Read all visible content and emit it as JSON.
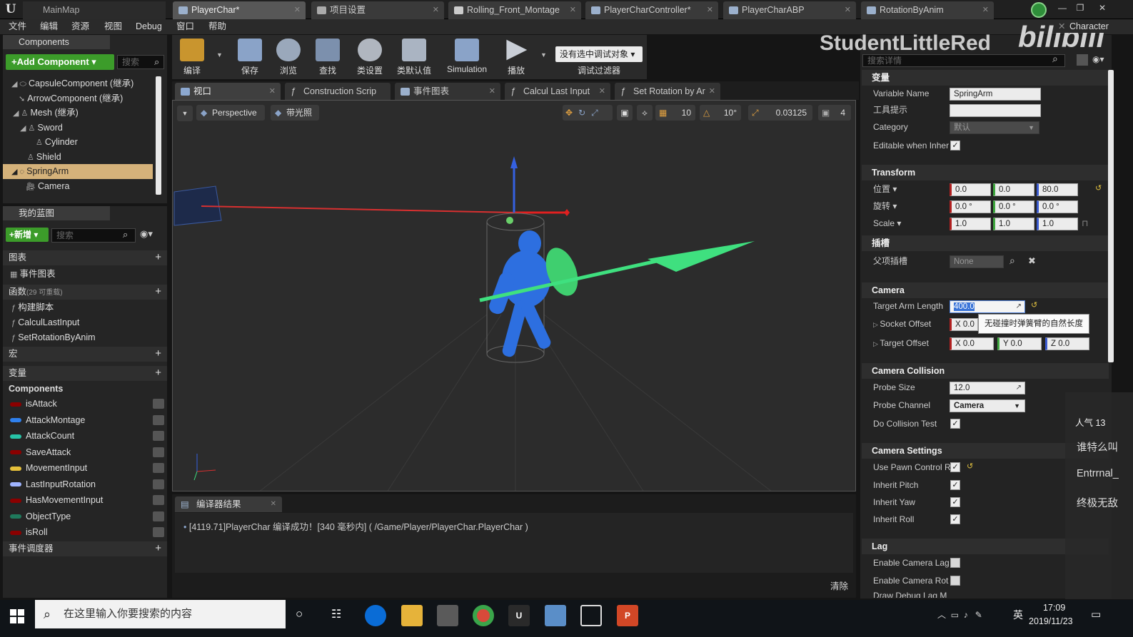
{
  "window_tabs": {
    "main": "MainMap",
    "docs": [
      {
        "label": "PlayerChar*",
        "active": true
      },
      {
        "label": "项目设置",
        "active": false
      },
      {
        "label": "Rolling_Front_Montage",
        "active": false
      },
      {
        "label": "PlayerCharController*",
        "active": false
      },
      {
        "label": "PlayerCharABP",
        "active": false
      },
      {
        "label": "RotationByAnim",
        "active": false
      }
    ],
    "right_label": "Character"
  },
  "menu": [
    "文件",
    "编辑",
    "资源",
    "视图",
    "Debug",
    "窗口",
    "帮助"
  ],
  "components_panel": {
    "title": "Components",
    "add_button": "+Add Component ▾",
    "search_placeholder": "搜索",
    "tree": [
      {
        "label": "CapsuleComponent (继承)",
        "indent": 0,
        "selected": false
      },
      {
        "label": "ArrowComponent (继承)",
        "indent": 1,
        "selected": false
      },
      {
        "label": "Mesh (继承)",
        "indent": 1,
        "selected": false
      },
      {
        "label": "Sword",
        "indent": 2,
        "selected": false
      },
      {
        "label": "Cylinder",
        "indent": 3,
        "selected": false
      },
      {
        "label": "Shield",
        "indent": 2,
        "selected": false
      },
      {
        "label": "SpringArm",
        "indent": 1,
        "selected": true
      },
      {
        "label": "Camera",
        "indent": 2,
        "selected": false
      }
    ]
  },
  "my_blueprint": {
    "title": "我的蓝图",
    "new_button": "+新增 ▾",
    "search_placeholder": "搜索",
    "sections": {
      "graphs": "图表",
      "event_graph": "事件图表",
      "functions": "函数",
      "functions_count": "(29 可重载)",
      "macros": "宏",
      "variables": "变量",
      "components": "Components",
      "dispatchers": "事件调度器"
    },
    "functions_list": [
      "构建脚本",
      "CalculLastInput",
      "SetRotationByAnim"
    ],
    "variables_list": [
      {
        "name": "isAttack",
        "color": "#8b0000"
      },
      {
        "name": "AttackMontage",
        "color": "#2f80ed"
      },
      {
        "name": "AttackCount",
        "color": "#27c3a6"
      },
      {
        "name": "SaveAttack",
        "color": "#8b0000"
      },
      {
        "name": "MovementInput",
        "color": "#e5c03a"
      },
      {
        "name": "LastInputRotation",
        "color": "#9fb4ff"
      },
      {
        "name": "HasMovementInput",
        "color": "#8b0000"
      },
      {
        "name": "ObjectType",
        "color": "#1f7a5c"
      },
      {
        "name": "isRoll",
        "color": "#8b0000"
      }
    ]
  },
  "toolbar": {
    "buttons": [
      "编译",
      "保存",
      "浏览",
      "查找",
      "类设置",
      "类默认值",
      "Simulation",
      "播放"
    ],
    "debug_select": "没有选中调试对象 ▾",
    "debug_filter": "调试过滤器"
  },
  "editor_tabs": [
    "视口",
    "Construction Scrip",
    "事件图表",
    "Calcul Last Input",
    "Set Rotation by Ar"
  ],
  "viewport": {
    "perspective": "Perspective",
    "lit": "带光照",
    "grid_snap": "10",
    "rot_snap": "10°",
    "scale_snap": "0.03125",
    "cam_speed": "4"
  },
  "compiler": {
    "tab": "编译器结果",
    "message": "[4119.71]PlayerChar 编译成功！[340 毫秒内] ( /Game/Player/PlayerChar.PlayerChar )",
    "clear": "清除"
  },
  "watermark": {
    "name": "StudentLittleRed",
    "site": "bilibili"
  },
  "details": {
    "search_placeholder": "搜索详情",
    "variable_section": "变量",
    "variable_name_label": "Variable Name",
    "variable_name": "SpringArm",
    "tooltip_label": "工具提示",
    "tooltip_value": "",
    "category_label": "Category",
    "category_value": "默认",
    "editable_label": "Editable when Inher",
    "transform": "Transform",
    "location_label": "位置 ▾",
    "location": [
      "0.0",
      "0.0",
      "80.0"
    ],
    "rotation_label": "旋转 ▾",
    "rotation": [
      "0.0 °",
      "0.0 °",
      "0.0 °"
    ],
    "scale_label": "Scale ▾",
    "scale": [
      "1.0",
      "1.0",
      "1.0"
    ],
    "socket_section": "插槽",
    "parent_socket_label": "父项插槽",
    "parent_socket": "None",
    "camera_section": "Camera",
    "target_arm_label": "Target Arm Length",
    "target_arm": "400.0",
    "tooltip_popup": "无碰撞时弹簧臂的自然长度",
    "socket_offset_label": "Socket Offset",
    "socket_offset_x": "X  0.0",
    "target_offset_label": "Target Offset",
    "target_offset": [
      "X  0.0",
      "Y  0.0",
      "Z  0.0"
    ],
    "collision_section": "Camera Collision",
    "probe_size_label": "Probe Size",
    "probe_size": "12.0",
    "probe_channel_label": "Probe Channel",
    "probe_channel": "Camera",
    "do_collision_label": "Do Collision Test",
    "settings_section": "Camera Settings",
    "use_pawn_label": "Use Pawn Control R",
    "inherit_pitch_label": "Inherit Pitch",
    "inherit_yaw_label": "Inherit Yaw",
    "inherit_roll_label": "Inherit Roll",
    "lag_section": "Lag",
    "enable_lag_label": "Enable Camera Lag",
    "enable_rot_lag_label": "Enable Camera Rot",
    "draw_debug_label": "Draw Debug Lag M"
  },
  "danmaku": {
    "popularity": "人气  13",
    "msgs": [
      "谁特么叫",
      "Entrrnal_",
      "终极无敌"
    ]
  },
  "taskbar": {
    "search_placeholder": "在这里输入你要搜索的内容",
    "ime": "英",
    "time": "17:09",
    "date": "2019/11/23"
  }
}
